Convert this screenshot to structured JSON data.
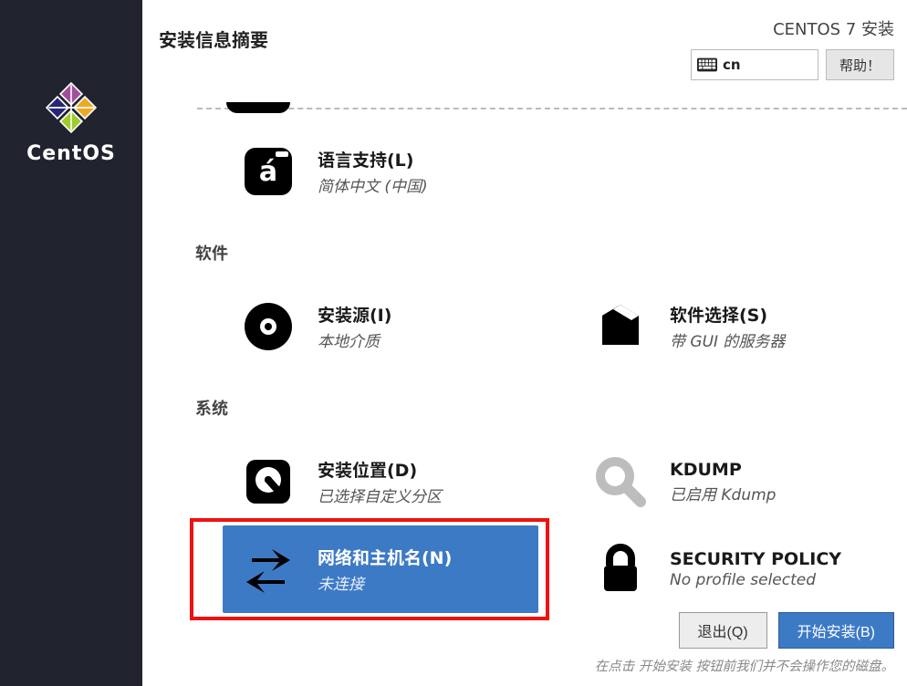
{
  "brand": "CentOS",
  "header": {
    "title": "安装信息摘要",
    "product": "CENTOS 7 安装",
    "keyboard_layout": "cn",
    "help_label": "帮助！"
  },
  "sections": {
    "localization": {
      "language": {
        "label": "语言支持(L)",
        "status": "简体中文 (中国)"
      }
    },
    "software_title": "软件",
    "software": {
      "source": {
        "label": "安装源(I)",
        "status": "本地介质"
      },
      "selection": {
        "label": "软件选择(S)",
        "status": "带 GUI 的服务器"
      }
    },
    "system_title": "系统",
    "system": {
      "destination": {
        "label": "安装位置(D)",
        "status": "已选择自定义分区"
      },
      "kdump": {
        "label": "KDUMP",
        "status": "已启用 Kdump"
      },
      "network": {
        "label": "网络和主机名(N)",
        "status": "未连接"
      },
      "security": {
        "label": "SECURITY POLICY",
        "status": "No profile selected"
      }
    }
  },
  "footer": {
    "quit_label": "退出(Q)",
    "begin_label": "开始安装(B)",
    "hint": "在点击 开始安装 按钮前我们并不会操作您的磁盘。"
  }
}
